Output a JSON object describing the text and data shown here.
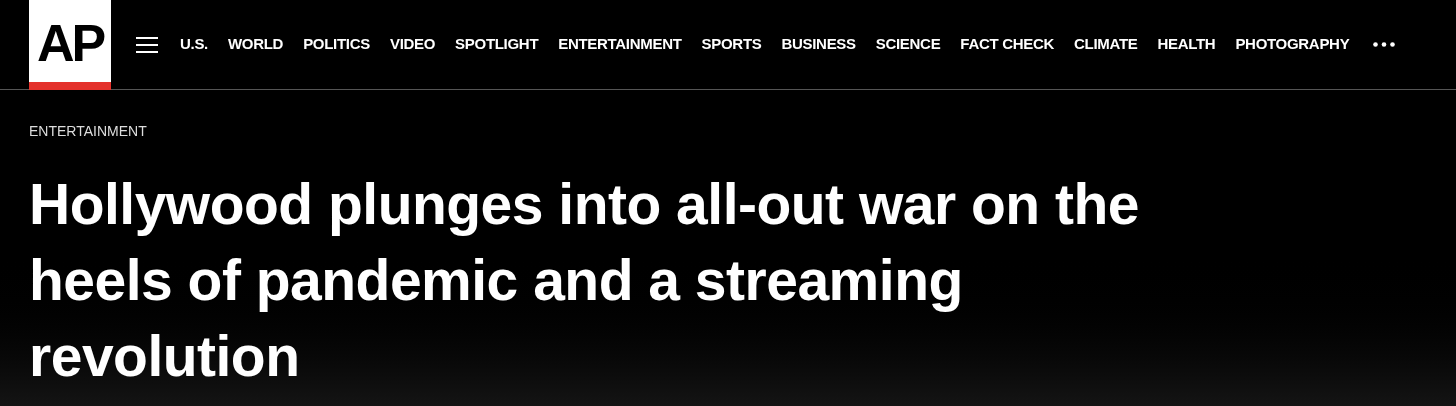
{
  "logo": {
    "text": "AP"
  },
  "nav": {
    "items": [
      "U.S.",
      "WORLD",
      "POLITICS",
      "VIDEO",
      "SPOTLIGHT",
      "ENTERTAINMENT",
      "SPORTS",
      "BUSINESS",
      "SCIENCE",
      "FACT CHECK",
      "CLIMATE",
      "HEALTH",
      "PHOTOGRAPHY"
    ]
  },
  "article": {
    "section": "ENTERTAINMENT",
    "headline": "Hollywood plunges into all-out war on the heels of pandemic and a streaming revolution"
  }
}
